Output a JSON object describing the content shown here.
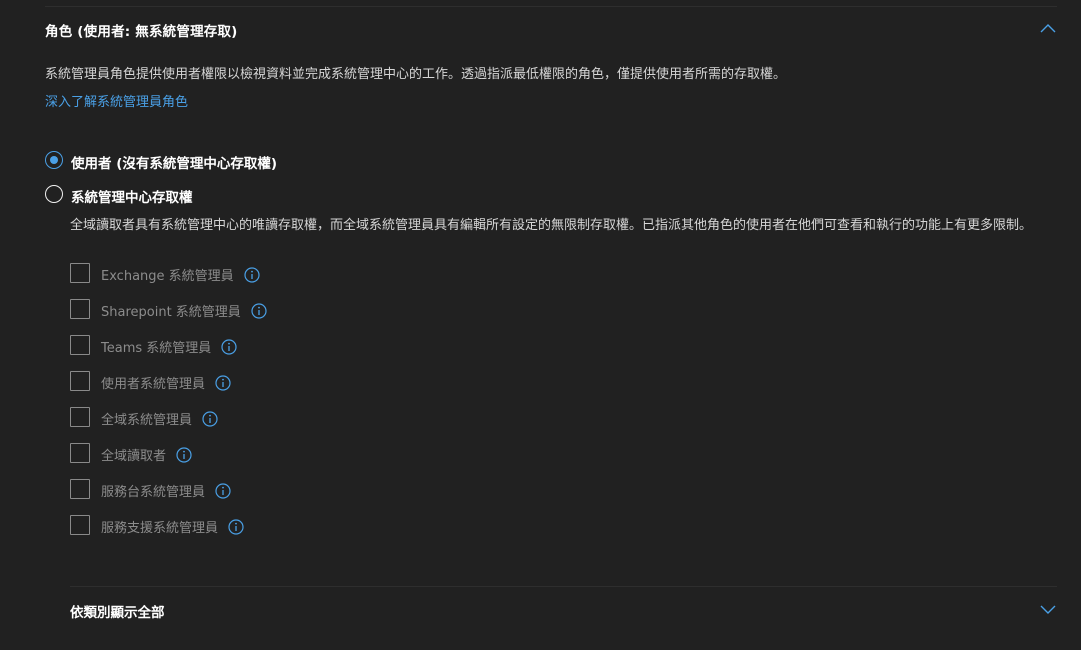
{
  "section": {
    "title": "角色 (使用者: 無系統管理存取)",
    "description": "系統管理員角色提供使用者權限以檢視資料並完成系統管理中心的工作。透過指派最低權限的角色，僅提供使用者所需的存取權。",
    "learn_more_link": "深入了解系統管理員角色"
  },
  "role_options": [
    {
      "label": "使用者 (沒有系統管理中心存取權)",
      "selected": true
    },
    {
      "label": "系統管理中心存取權",
      "selected": false
    }
  ],
  "admin_access": {
    "description": "全域讀取者具有系統管理中心的唯讀存取權，而全域系統管理員具有編輯所有設定的無限制存取權。已指派其他角色的使用者在他們可查看和執行的功能上有更多限制。",
    "roles": [
      {
        "label": "Exchange 系統管理員",
        "checked": false
      },
      {
        "label": "Sharepoint 系統管理員",
        "checked": false
      },
      {
        "label": "Teams 系統管理員",
        "checked": false
      },
      {
        "label": "使用者系統管理員",
        "checked": false
      },
      {
        "label": "全域系統管理員",
        "checked": false
      },
      {
        "label": "全域讀取者",
        "checked": false
      },
      {
        "label": "服務台系統管理員",
        "checked": false
      },
      {
        "label": "服務支援系統管理員",
        "checked": false
      }
    ]
  },
  "show_all_by_category": "依類別顯示全部",
  "colors": {
    "background": "#212121",
    "accent": "#4aa0e6",
    "disabled_text": "#8c8c8c"
  },
  "icons": {
    "section_toggle": "chevron-up-icon",
    "group_toggle": "chevron-down-icon",
    "role_info": "info-icon"
  }
}
